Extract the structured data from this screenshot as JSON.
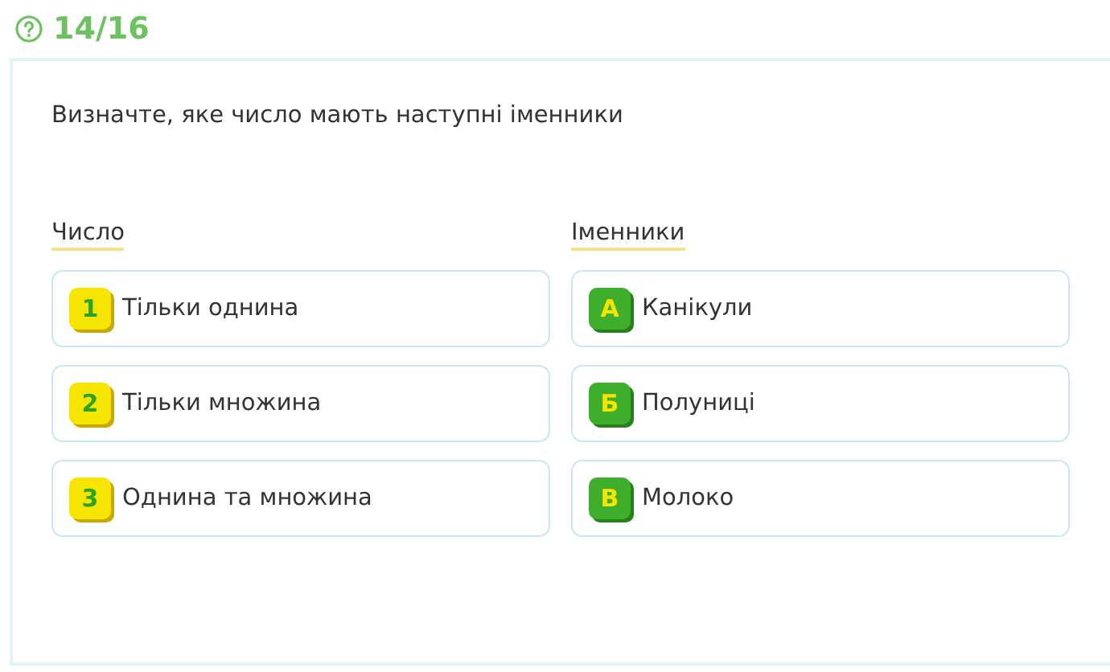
{
  "progress": {
    "counter": "14/16"
  },
  "question": "Визначте, яке число мають наступні іменники",
  "columns": [
    {
      "heading": "Число",
      "kind": "number",
      "items": [
        {
          "badge": "1",
          "text": "Тільки однина"
        },
        {
          "badge": "2",
          "text": "Тільки множина"
        },
        {
          "badge": "3",
          "text": "Однина та множина"
        }
      ]
    },
    {
      "heading": "Іменники",
      "kind": "letter",
      "items": [
        {
          "badge": "А",
          "text": "Канікули"
        },
        {
          "badge": "Б",
          "text": "Полуниці"
        },
        {
          "badge": "В",
          "text": "Молоко"
        }
      ]
    }
  ]
}
